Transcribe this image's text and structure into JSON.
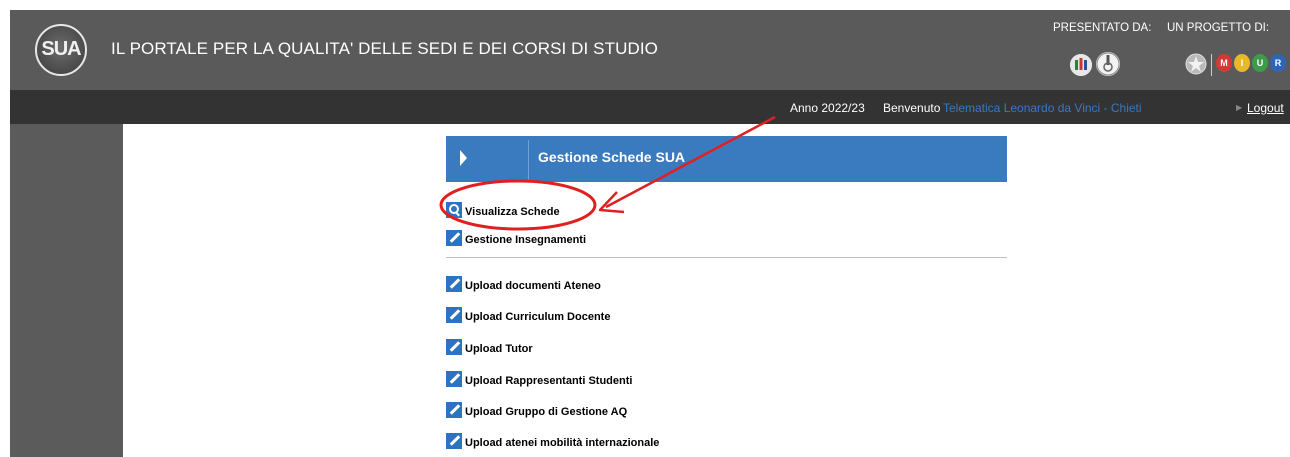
{
  "header": {
    "title": "IL PORTALE PER LA QUALITA' DELLE SEDI E DEI CORSI DI STUDIO",
    "logo_text": "SUA",
    "presented_by_label": "PRESENTATO DA:",
    "project_of_label": "UN PROGETTO DI:",
    "miur_letters": [
      "M",
      "I",
      "U",
      "R"
    ]
  },
  "nav": {
    "anno": "Anno 2022/23",
    "benvenuto": "Benvenuto",
    "university": "Telematica Leonardo da Vinci - Chieti",
    "logout": "Logout"
  },
  "panel": {
    "title": "Gestione Schede SUA"
  },
  "menu": [
    {
      "label": "Visualizza Schede",
      "icon": "search-icon"
    },
    {
      "label": "Gestione Insegnamenti",
      "icon": "pencil-icon"
    },
    {
      "label": "Upload documenti Ateneo",
      "icon": "pencil-icon"
    },
    {
      "label": "Upload Curriculum Docente",
      "icon": "pencil-icon"
    },
    {
      "label": "Upload Tutor",
      "icon": "pencil-icon"
    },
    {
      "label": "Upload Rappresentanti Studenti",
      "icon": "pencil-icon"
    },
    {
      "label": "Upload Gruppo di Gestione AQ",
      "icon": "pencil-icon"
    },
    {
      "label": "Upload atenei mobilità internazionale",
      "icon": "pencil-icon"
    }
  ],
  "colors": {
    "header_bg": "#5a5a5a",
    "nav_bg": "#333333",
    "accent_blue": "#3a7bbf",
    "annotation_red": "#e02020"
  }
}
